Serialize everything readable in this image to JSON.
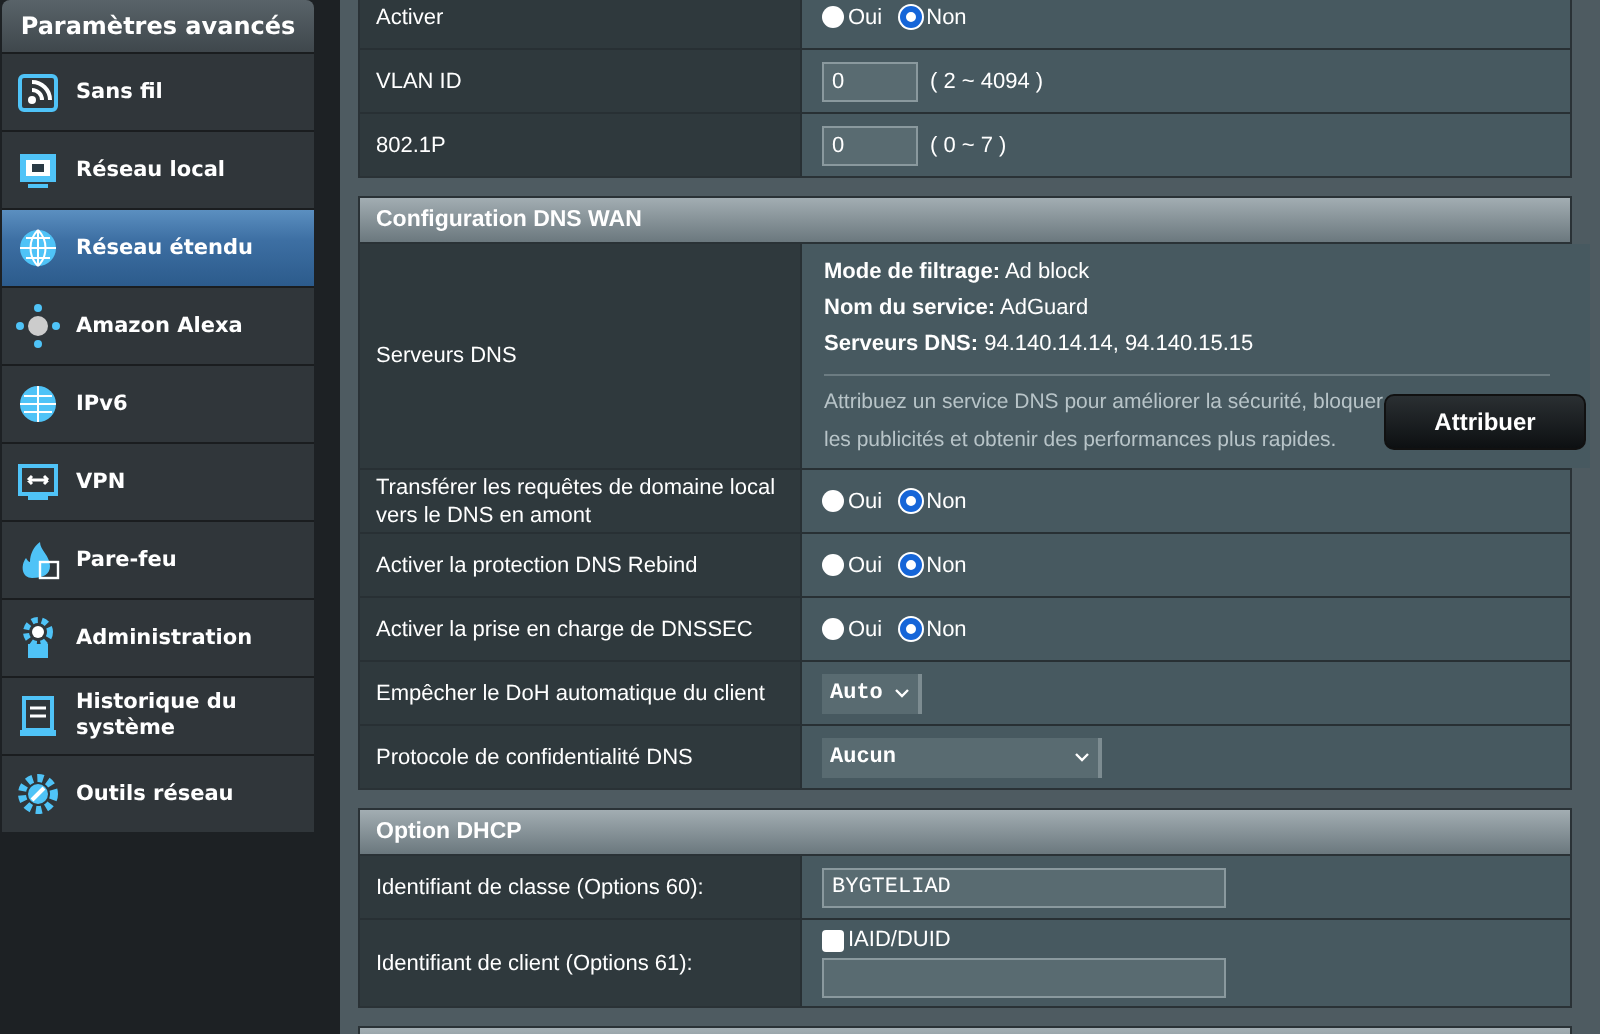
{
  "sidebar": {
    "title": "Paramètres avancés",
    "items": [
      {
        "label": "Sans fil",
        "selected": false
      },
      {
        "label": "Réseau local",
        "selected": false
      },
      {
        "label": "Réseau étendu",
        "selected": true
      },
      {
        "label": "Amazon Alexa",
        "selected": false
      },
      {
        "label": "IPv6",
        "selected": false
      },
      {
        "label": "VPN",
        "selected": false
      },
      {
        "label": "Pare-feu",
        "selected": false
      },
      {
        "label": "Administration",
        "selected": false
      },
      {
        "label": "Historique du système",
        "selected": false
      },
      {
        "label": "Outils réseau",
        "selected": false
      }
    ]
  },
  "sections": [
    {
      "rows": [
        {
          "label": "Activer",
          "kind": "radio",
          "options": [
            {
              "label": "Oui",
              "selected": false
            },
            {
              "label": "Non",
              "selected": true
            }
          ]
        },
        {
          "label": "VLAN ID",
          "kind": "input",
          "value": "0",
          "hint": "( 2 ~ 4094 )"
        },
        {
          "label": "802.1P",
          "kind": "input",
          "value": "0",
          "hint": "( 0 ~ 7 )"
        }
      ]
    },
    {
      "title": "Configuration DNS WAN",
      "rows": [
        {
          "label": "Serveurs DNS",
          "kind": "dns",
          "info": [
            "**Mode de filtrage:** Ad block",
            "**Nom du service:** AdGuard",
            "**Serveurs DNS:** 94.140.14.14, 94.140.15.15"
          ],
          "note": "Attribuez un service DNS pour améliorer la sécurité, bloquer les publicités et obtenir des performances plus rapides.",
          "button": "Attribuer"
        },
        {
          "label": "Transférer les requêtes de domaine local vers le DNS en amont",
          "kind": "radio",
          "options": [
            {
              "label": "Oui",
              "selected": false
            },
            {
              "label": "Non",
              "selected": true
            }
          ]
        },
        {
          "label": "Activer la protection DNS Rebind",
          "kind": "radio",
          "options": [
            {
              "label": "Oui",
              "selected": false
            },
            {
              "label": "Non",
              "selected": true
            }
          ]
        },
        {
          "label": "Activer la prise en charge de DNSSEC",
          "kind": "radio",
          "options": [
            {
              "label": "Oui",
              "selected": false
            },
            {
              "label": "Non",
              "selected": true
            }
          ]
        },
        {
          "label": "Empêcher le DoH automatique du client",
          "kind": "select",
          "value": "Auto"
        },
        {
          "label": "Protocole de confidentialité DNS",
          "kind": "wide_select",
          "value": "Aucun"
        }
      ]
    },
    {
      "title": "Option DHCP",
      "rows": [
        {
          "label": "Identifiant de classe (Options 60):",
          "kind": "text",
          "value": "BYGTELIAD"
        },
        {
          "label": "Identifiant de client (Options 61):",
          "kind": "checkbox_text",
          "check_label": "IAID/DUID",
          "checked": false
        }
      ]
    }
  ]
}
